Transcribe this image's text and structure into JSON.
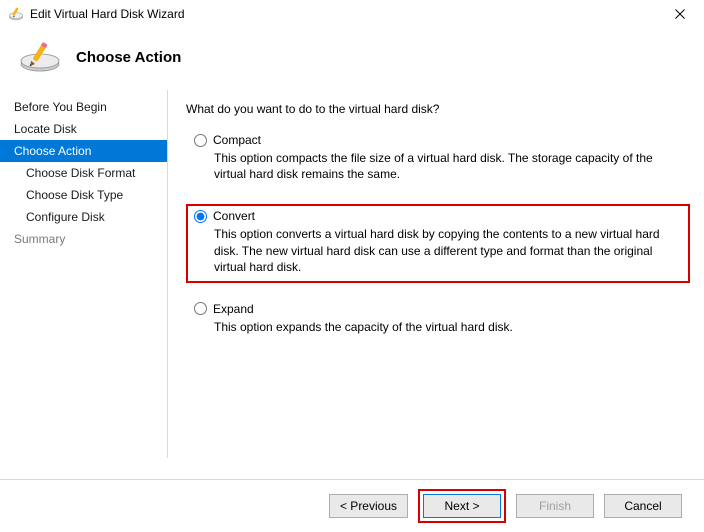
{
  "window": {
    "title": "Edit Virtual Hard Disk Wizard"
  },
  "header": {
    "page_title": "Choose Action"
  },
  "sidebar": {
    "items": [
      {
        "label": "Before You Begin"
      },
      {
        "label": "Locate Disk"
      },
      {
        "label": "Choose Action"
      },
      {
        "label": "Choose Disk Format"
      },
      {
        "label": "Choose Disk Type"
      },
      {
        "label": "Configure Disk"
      },
      {
        "label": "Summary"
      }
    ]
  },
  "content": {
    "prompt": "What do you want to do to the virtual hard disk?",
    "options": {
      "compact": {
        "label": "Compact",
        "description": "This option compacts the file size of a virtual hard disk. The storage capacity of the virtual hard disk remains the same."
      },
      "convert": {
        "label": "Convert",
        "description": "This option converts a virtual hard disk by copying the contents to a new virtual hard disk. The new virtual hard disk can use a different type and format than the original virtual hard disk."
      },
      "expand": {
        "label": "Expand",
        "description": "This option expands the capacity of the virtual hard disk."
      }
    }
  },
  "footer": {
    "previous": "< Previous",
    "next": "Next >",
    "finish": "Finish",
    "cancel": "Cancel"
  }
}
